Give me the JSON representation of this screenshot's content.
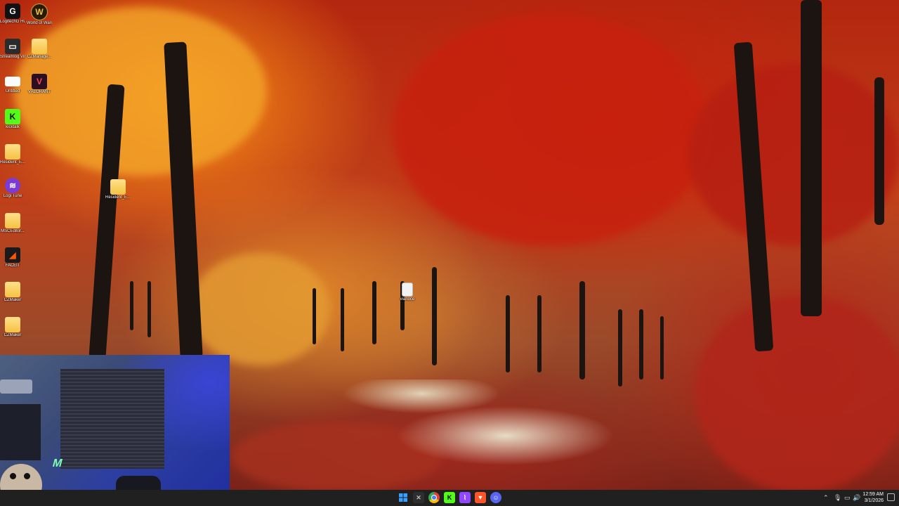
{
  "desktop": {
    "icons": [
      {
        "label": "LogitechG HUB",
        "icon": "logitech-g-icon"
      },
      {
        "label": "World of Warcraft",
        "icon": "wow-icon"
      },
      {
        "label": "Streamlog VirtualCam",
        "icon": "streamlog-icon"
      },
      {
        "label": "CZManage...",
        "icon": "folder-icon"
      },
      {
        "label": "Untitled",
        "icon": "document-icon"
      },
      {
        "label": "VALORANT",
        "icon": "valorant-icon"
      },
      {
        "label": "kicktalk",
        "icon": "kicktalk-icon"
      },
      {
        "label": "Resident_E...",
        "icon": "folder-icon"
      },
      {
        "label": "Resident_E...",
        "icon": "folder-icon"
      },
      {
        "label": "Logi Tune",
        "icon": "logi-tune-icon"
      },
      {
        "label": "MSCEditor...",
        "icon": "folder-icon"
      },
      {
        "label": "FACEIT",
        "icon": "faceit-icon"
      },
      {
        "label": "CZMaker",
        "icon": "folder-icon"
      },
      {
        "label": "CZMaker",
        "icon": "folder-icon"
      },
      {
        "label": "vianoce",
        "icon": "text-file-icon"
      }
    ]
  },
  "taskbar": {
    "apps": [
      {
        "name": "start-button",
        "icon": "windows-icon",
        "color": "#3aa0ff"
      },
      {
        "name": "xbox",
        "icon": "xbox-icon",
        "color": "#2e2e2e"
      },
      {
        "name": "chrome",
        "icon": "chrome-icon",
        "color": "#e34133"
      },
      {
        "name": "kick",
        "icon": "kick-icon",
        "color": "#53fc18"
      },
      {
        "name": "twitch",
        "icon": "twitch-icon",
        "color": "#9146ff"
      },
      {
        "name": "brave",
        "icon": "brave-icon",
        "color": "#fb542b"
      },
      {
        "name": "discord",
        "icon": "discord-icon",
        "color": "#5865f2"
      }
    ],
    "clock": {
      "time": "12:59 AM",
      "date": "3/1/2026"
    }
  }
}
